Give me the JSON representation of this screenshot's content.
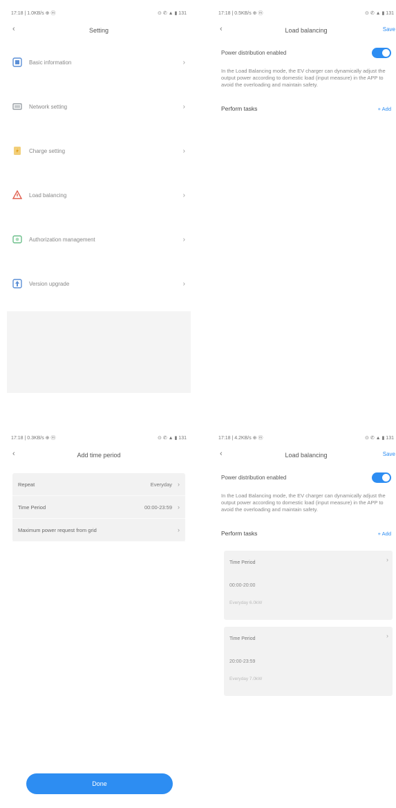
{
  "screen1": {
    "status_left": "17:18 | 1.0KB/s ⊕ ⓜ",
    "status_right": "⊙ ✆ ▲ ▮ 131",
    "title": "Setting",
    "back_icon": "‹",
    "items": [
      {
        "label": "Basic information",
        "icon": "info-icon",
        "color": "#5b8fd6"
      },
      {
        "label": "Network setting",
        "icon": "network-icon",
        "color": "#9aa0a6"
      },
      {
        "label": "Charge setting",
        "icon": "charge-icon",
        "color": "#e6b54a"
      },
      {
        "label": "Load balancing",
        "icon": "load-icon",
        "color": "#e06050"
      },
      {
        "label": "Authorization management",
        "icon": "auth-icon",
        "color": "#6bbf8a"
      },
      {
        "label": "Version upgrade",
        "icon": "upgrade-icon",
        "color": "#5b8fd6"
      }
    ],
    "chevron": "›"
  },
  "screen2": {
    "status_left": "17:18 | 0.5KB/s ⊕ ⓜ",
    "status_right": "⊙ ✆ ▲ ▮ 131",
    "title": "Load balancing",
    "action": "Save",
    "switch_label": "Power distribution enabled",
    "description": "In the Load Balancing mode, the EV charger can dynamically adjust the output power according to domestic load (input measure) in the APP to avoid the overloading and maintain safety.",
    "perform_label": "Perform tasks",
    "add_label": "+ Add"
  },
  "screen3": {
    "status_left": "17:18 | 0.3KB/s ⊕ ⓜ",
    "status_right": "⊙ ✆ ▲ ▮ 131",
    "title": "Add time period",
    "rows": [
      {
        "key": "Repeat",
        "value": "Everyday"
      },
      {
        "key": "Time Period",
        "value": "00:00-23:59"
      },
      {
        "key": "Maximum power request from grid",
        "value": ""
      }
    ],
    "done_label": "Done"
  },
  "screen4": {
    "status_left": "17:18 | 4.2KB/s ⊕ ⓜ",
    "status_right": "⊙ ✆ ▲ ▮ 131",
    "title": "Load balancing",
    "action": "Save",
    "switch_label": "Power distribution enabled",
    "description": "In the Load Balancing mode, the EV charger can dynamically adjust the output power according to domestic load (input measure) in the APP to avoid the overloading and maintain safety.",
    "perform_label": "Perform tasks",
    "add_label": "+ Add",
    "cards": [
      {
        "line1": "Time Period",
        "line2": "00:00-20:00",
        "line3": "Everyday 6.0kW"
      },
      {
        "line1": "Time Period",
        "line2": "20:00-23:59",
        "line3": "Everyday 7.0kW"
      }
    ]
  },
  "colors": {
    "accent": "#2d8df2"
  }
}
